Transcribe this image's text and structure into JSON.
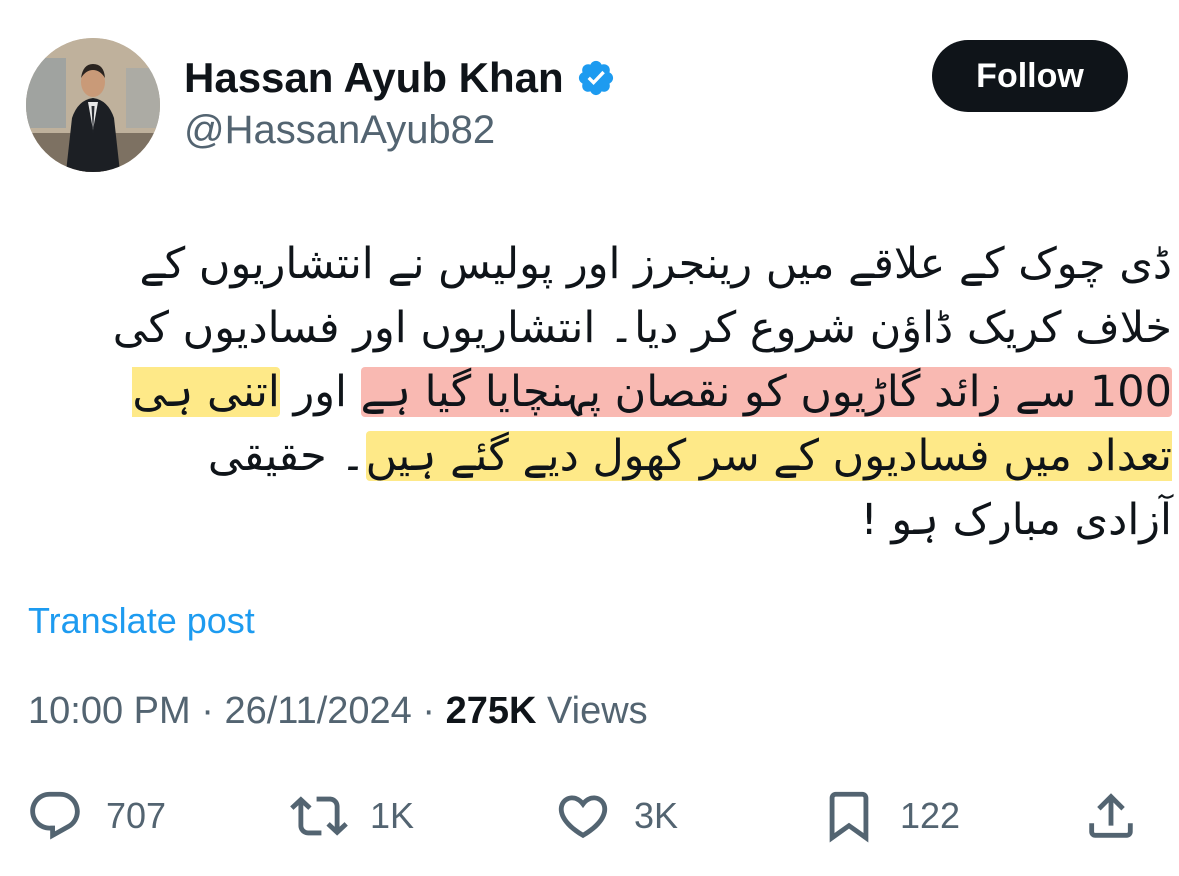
{
  "author": {
    "name": "Hassan Ayub Khan",
    "handle": "@HassanAyub82",
    "verified": true,
    "avatar": "profile-photo-man-in-suit"
  },
  "follow_label": "Follow",
  "post": {
    "segments": [
      {
        "text": "ڈی چوک کے علاقے میں رینجرز اور پولیس نے انتشاریوں کے خلاف کریک ڈاؤن شروع کر دیا۔ انتشاریوں اور فسادیوں کی ",
        "highlight": "none"
      },
      {
        "text": "100 سے زائد گاڑیوں کو نقصان پہنچایا گیا ہے",
        "highlight": "red"
      },
      {
        "text": " اور ",
        "highlight": "none"
      },
      {
        "text": "اتنی ہی تعداد میں فسادیوں کے سر کھول دیے گئے ہیں",
        "highlight": "yellow"
      },
      {
        "text": "۔ حقیقی آزادی مبارک ہو !",
        "highlight": "none"
      }
    ],
    "colors": {
      "highlight_red": "#f47f72",
      "highlight_yellow": "#fedd48"
    }
  },
  "translate_label": "Translate post",
  "meta": {
    "time": "10:00 PM",
    "date": "26/11/2024",
    "views_count": "275K",
    "views_label": "Views"
  },
  "actions": [
    {
      "icon": "reply-icon",
      "count": "707"
    },
    {
      "icon": "retweet-icon",
      "count": "1K"
    },
    {
      "icon": "like-icon",
      "count": "3K"
    },
    {
      "icon": "bookmark-icon",
      "count": "122"
    },
    {
      "icon": "share-icon",
      "count": ""
    }
  ],
  "colors": {
    "text": "#0f1419",
    "secondary": "#536471",
    "link": "#1d9bf0",
    "verified": "#1d9bf0"
  }
}
